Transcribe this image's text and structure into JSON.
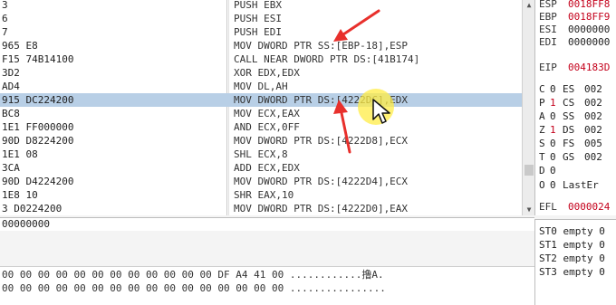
{
  "disasm": {
    "rows": [
      {
        "addr": "3",
        "instr": "PUSH EBX",
        "selected": false
      },
      {
        "addr": "6",
        "instr": "PUSH ESI",
        "selected": false
      },
      {
        "addr": "7",
        "instr": "PUSH EDI",
        "selected": false
      },
      {
        "addr": "965 E8",
        "instr": "MOV DWORD PTR SS:[EBP-18],ESP",
        "selected": false
      },
      {
        "addr": "F15 74B14100",
        "instr": "CALL NEAR DWORD PTR DS:[41B174]",
        "selected": false
      },
      {
        "addr": "3D2",
        "instr": "XOR EDX,EDX",
        "selected": false
      },
      {
        "addr": "AD4",
        "instr": "MOV DL,AH",
        "selected": false
      },
      {
        "addr": "915 DC224200",
        "instr": "MOV DWORD PTR DS:[4222DC],EDX",
        "selected": true
      },
      {
        "addr": "BC8",
        "instr": "MOV ECX,EAX",
        "selected": false
      },
      {
        "addr": "1E1 FF000000",
        "instr": "AND ECX,0FF",
        "selected": false
      },
      {
        "addr": "90D D8224200",
        "instr": "MOV DWORD PTR DS:[4222D8],ECX",
        "selected": false
      },
      {
        "addr": "1E1 08",
        "instr": "SHL ECX,8",
        "selected": false
      },
      {
        "addr": "3CA",
        "instr": "ADD ECX,EDX",
        "selected": false
      },
      {
        "addr": "90D D4224200",
        "instr": "MOV DWORD PTR DS:[4222D4],ECX",
        "selected": false
      },
      {
        "addr": "1E8 10",
        "instr": "SHR EAX,10",
        "selected": false
      },
      {
        "addr": "3 D0224200",
        "instr": "MOV DWORD PTR DS:[4222D0],EAX",
        "selected": false
      }
    ]
  },
  "infoline": "00000000",
  "registers": [
    {
      "name": "ESP",
      "value": "0018FF8",
      "color": "red"
    },
    {
      "name": "EBP",
      "value": "0018FF9",
      "color": "red"
    },
    {
      "name": "ESI",
      "value": "0000000",
      "color": "black"
    },
    {
      "name": "EDI",
      "value": "0000000",
      "color": "black"
    },
    {
      "name": "EIP",
      "value": "004183D",
      "color": "red"
    }
  ],
  "flags": [
    {
      "flag": "C",
      "val": "0",
      "seg": "ES",
      "segval": "002",
      "red": false
    },
    {
      "flag": "P",
      "val": "1",
      "seg": "CS",
      "segval": "002",
      "red": true
    },
    {
      "flag": "A",
      "val": "0",
      "seg": "SS",
      "segval": "002",
      "red": false
    },
    {
      "flag": "Z",
      "val": "1",
      "seg": "DS",
      "segval": "002",
      "red": true
    },
    {
      "flag": "S",
      "val": "0",
      "seg": "FS",
      "segval": "005",
      "red": false
    },
    {
      "flag": "T",
      "val": "0",
      "seg": "GS",
      "segval": "002",
      "red": false
    },
    {
      "flag": "D",
      "val": "0",
      "seg": "",
      "segval": "",
      "red": false
    }
  ],
  "lasterr": {
    "flag": "O",
    "val": "0",
    "label": "LastEr"
  },
  "efl": {
    "name": "EFL",
    "value": "0000024"
  },
  "fpu": [
    {
      "name": "ST0",
      "value": "empty 0"
    },
    {
      "name": "ST1",
      "value": "empty 0"
    },
    {
      "name": "ST2",
      "value": "empty 0"
    },
    {
      "name": "ST3",
      "value": "empty 0"
    }
  ],
  "dump": {
    "row1": "00 00 00 00 00 00 00 00 00 00 00 00 DF A4 41 00 ............撸A.",
    "row2": "00 00 00 00 00 00 00 00 00 00 00 00 00 00 00 00 ................"
  },
  "colors": {
    "selection": "#b8cfe6",
    "register_changed": "#c4001b",
    "annotation_arrow": "#e8302c",
    "cursor_highlight": "#ffec46"
  }
}
